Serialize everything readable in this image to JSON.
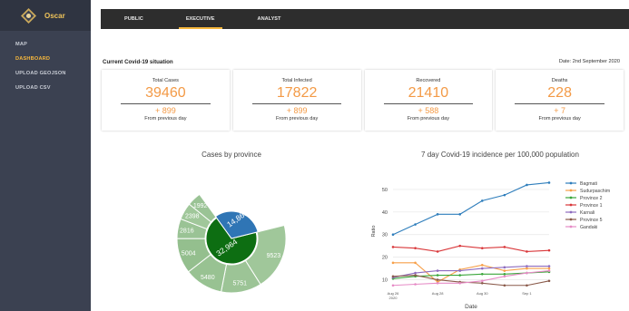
{
  "app": {
    "name": "Oscar",
    "colors": {
      "sidebar": "#3b4151",
      "accent": "#f5b63c",
      "stat": "#f39a46",
      "topbar": "#2d2d2d"
    }
  },
  "sidebar": {
    "items": [
      {
        "label": "MAP",
        "active": false
      },
      {
        "label": "DASHBOARD",
        "active": true
      },
      {
        "label": "UPLOAD GEOJSON",
        "active": false
      },
      {
        "label": "UPLOAD CSV",
        "active": false
      }
    ]
  },
  "tabs": [
    {
      "label": "PUBLIC",
      "active": false
    },
    {
      "label": "EXECUTIVE",
      "active": true
    },
    {
      "label": "ANALYST",
      "active": false
    }
  ],
  "situation": {
    "title": "Current Covid-19 situation",
    "date": "Date: 2nd September 2020"
  },
  "cards": [
    {
      "title": "Total Cases",
      "value": "39460",
      "delta": "+ 899",
      "sub": "From previous day"
    },
    {
      "title": "Total Infected",
      "value": "17822",
      "delta": "+ 899",
      "sub": "From previous day"
    },
    {
      "title": "Recovered",
      "value": "21410",
      "delta": "+ 588",
      "sub": "From previous day"
    },
    {
      "title": "Deaths",
      "value": "228",
      "delta": "+ 7",
      "sub": "From previous day"
    }
  ],
  "chart_data": [
    {
      "type": "pie",
      "title": "Cases by province",
      "inner": [
        {
          "label": "32,964",
          "value": 32964,
          "color": "#0d6e12"
        },
        {
          "label": "14,868",
          "value": 14868,
          "color": "#2f75b5"
        }
      ],
      "outer": [
        {
          "label": "9523",
          "value": 9523,
          "color": "#a0c79a"
        },
        {
          "label": "5751",
          "value": 5751,
          "color": "#9cc496"
        },
        {
          "label": "5480",
          "value": 5480,
          "color": "#98c292"
        },
        {
          "label": "5004",
          "value": 5004,
          "color": "#94bf8e"
        },
        {
          "label": "2816",
          "value": 2816,
          "color": "#9ac395"
        },
        {
          "label": "2398",
          "value": 2398,
          "color": "#a0c79a"
        },
        {
          "label": "1992",
          "value": 1992,
          "color": "#9ac395"
        }
      ]
    },
    {
      "type": "line",
      "title": "7 day Covid-19 incidence per 100,000 population",
      "xlabel": "Date",
      "ylabel": "Ratio",
      "x_ticks": [
        "Aug 26\n2020",
        "Aug 28",
        "Aug 30",
        "Sep 1"
      ],
      "y_ticks": [
        10,
        20,
        30,
        40,
        50
      ],
      "ylim": [
        7,
        56
      ],
      "legend": "right",
      "series": [
        {
          "name": "Bagmati",
          "color": "#2f7ebc",
          "values": [
            30,
            34.5,
            39,
            39,
            45,
            47.5,
            52,
            53
          ]
        },
        {
          "name": "Sudurpaschim",
          "color": "#f7a04a",
          "values": [
            17.5,
            17.5,
            9,
            14.5,
            16.5,
            14,
            15,
            15
          ]
        },
        {
          "name": "Province 2",
          "color": "#3aa63a",
          "values": [
            10.5,
            11.5,
            12,
            12,
            12.5,
            12.5,
            13,
            13.5
          ]
        },
        {
          "name": "Province 1",
          "color": "#d9373a",
          "values": [
            24.5,
            24,
            22.5,
            25,
            24,
            24.5,
            22.5,
            23
          ]
        },
        {
          "name": "Karnali",
          "color": "#8e6cbf",
          "values": [
            11,
            13,
            14,
            14,
            15,
            15.5,
            16,
            16
          ]
        },
        {
          "name": "Province 5",
          "color": "#8a5a4a",
          "values": [
            11.5,
            12,
            10,
            9,
            8.5,
            7.5,
            7.5,
            9.5
          ]
        },
        {
          "name": "Gandaki",
          "color": "#e68bc6",
          "values": [
            7.5,
            8,
            8.5,
            8.5,
            9.5,
            11.5,
            13,
            14
          ]
        }
      ]
    }
  ]
}
